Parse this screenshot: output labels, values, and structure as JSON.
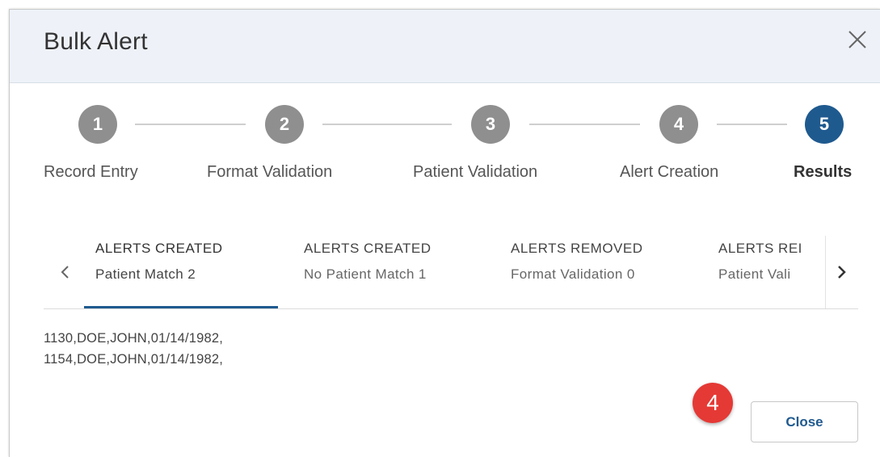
{
  "dialog": {
    "title": "Bulk Alert",
    "close_icon": "close-icon"
  },
  "stepper": {
    "steps": [
      {
        "number": "1",
        "label": "Record Entry",
        "active": false
      },
      {
        "number": "2",
        "label": "Format Validation",
        "active": false
      },
      {
        "number": "3",
        "label": "Patient Validation",
        "active": false
      },
      {
        "number": "4",
        "label": "Alert Creation",
        "active": false
      },
      {
        "number": "5",
        "label": "Results",
        "active": true
      }
    ],
    "colors": {
      "inactive": "#8f8f8f",
      "active": "#1f5a8f"
    }
  },
  "tabs": {
    "prev_icon": "chevron-left-icon",
    "next_icon": "chevron-right-icon",
    "items": [
      {
        "title": "ALERTS CREATED",
        "subtitle": "Patient Match 2",
        "active": true
      },
      {
        "title": "ALERTS CREATED",
        "subtitle": "No Patient Match 1",
        "active": false
      },
      {
        "title": "ALERTS REMOVED",
        "subtitle": "Format Validation 0",
        "active": false
      },
      {
        "title": "ALERTS REI",
        "subtitle": "Patient Vali",
        "active": false
      }
    ]
  },
  "results": {
    "lines": [
      "1130,DOE,JOHN,01/14/1982,",
      "1154,DOE,JOHN,01/14/1982,"
    ]
  },
  "footer": {
    "close_label": "Close",
    "badge": "4",
    "badge_color": "#e53935"
  }
}
